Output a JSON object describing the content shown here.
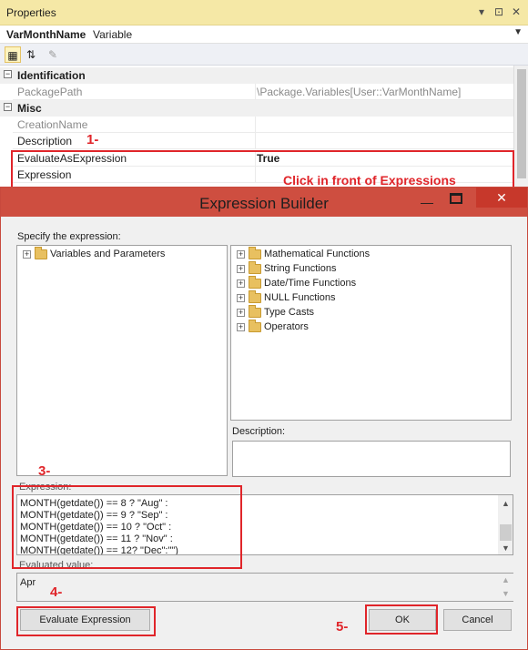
{
  "properties_panel": {
    "title": "Properties",
    "controls": {
      "dropdown": "▾",
      "pin": "⊡",
      "close": "✕"
    },
    "object_name": "VarMonthName",
    "object_type": "Variable",
    "categories": {
      "identification": "Identification",
      "misc": "Misc"
    },
    "rows": {
      "package_path": {
        "key": "PackagePath",
        "value": "\\Package.Variables[User::VarMonthName]"
      },
      "creation_name": {
        "key": "CreationName",
        "value": ""
      },
      "description": {
        "key": "Description",
        "value": ""
      },
      "evaluate_as_expression": {
        "key": "EvaluateAsExpression",
        "value": "True"
      },
      "expression": {
        "key": "Expression",
        "value": ""
      }
    }
  },
  "dialog": {
    "title": "Expression Builder",
    "specify_label": "Specify the expression:",
    "left_tree": [
      "Variables and Parameters"
    ],
    "right_tree": [
      "Mathematical Functions",
      "String Functions",
      "Date/Time Functions",
      "NULL Functions",
      "Type Casts",
      "Operators"
    ],
    "description_label": "Description:",
    "expression_label": "Expression:",
    "expression_lines": [
      "MONTH(getdate()) == 8 ? \"Aug\" :",
      "MONTH(getdate()) == 9 ? \"Sep\" :",
      "MONTH(getdate()) == 10 ? \"Oct\" :",
      "MONTH(getdate()) == 11 ? \"Nov\" :",
      "MONTH(getdate()) == 12? \"Dec\":\"\")"
    ],
    "evaluated_label": "Evaluated value:",
    "evaluated_value": "Apr",
    "evaluate_button": "Evaluate Expression",
    "ok_button": "OK",
    "cancel_button": "Cancel"
  },
  "annotations": {
    "step1": "1-",
    "step3": "3-",
    "step4": "4-",
    "step5": "5-",
    "hint": "Click in front of Expressions",
    "color": "#e0252a"
  }
}
